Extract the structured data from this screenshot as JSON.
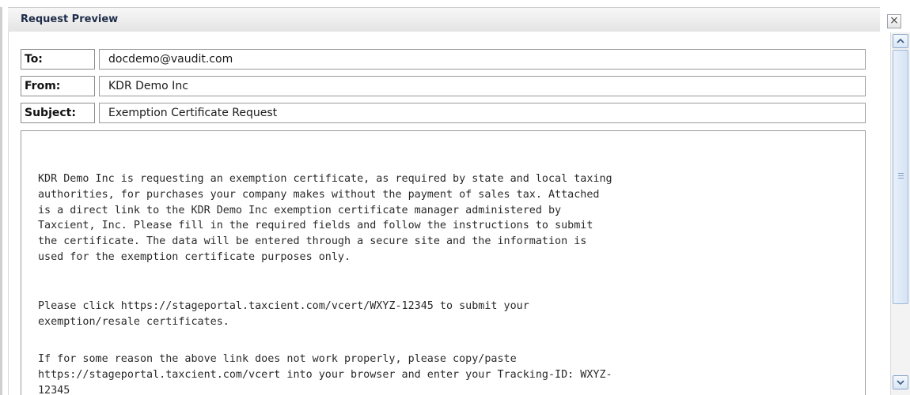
{
  "dialog": {
    "title": "Request Preview",
    "close_glyph": "×"
  },
  "header": {
    "to_label": "To:",
    "to_value": "docdemo@vaudit.com",
    "from_label": "From:",
    "from_value": "KDR Demo Inc",
    "subject_label": "Subject:",
    "subject_value": "Exemption Certificate Request"
  },
  "body": {
    "paragraph1": "KDR Demo Inc is requesting an exemption certificate, as required by state and local taxing\nauthorities, for purchases your company makes without the payment of sales tax. Attached\nis a direct link to the KDR Demo Inc exemption certificate manager administered by\nTaxcient, Inc. Please fill in the required fields and follow the instructions to submit\nthe certificate. The data will be entered through a secure site and the information is\nused for the exemption certificate purposes only.",
    "paragraph2": "Please click https://stageportal.taxcient.com/vcert/WXYZ-12345 to submit your\nexemption/resale certificates.",
    "paragraph3": "If for some reason the above link does not work properly, please copy/paste\nhttps://stageportal.taxcient.com/vcert into your browser and enter your Tracking-ID: WXYZ-\n12345"
  },
  "icons": {
    "close": "close-icon",
    "scroll_up": "chevron-up-icon",
    "scroll_down": "chevron-down-icon",
    "thumb_grip": "grip-icon"
  }
}
